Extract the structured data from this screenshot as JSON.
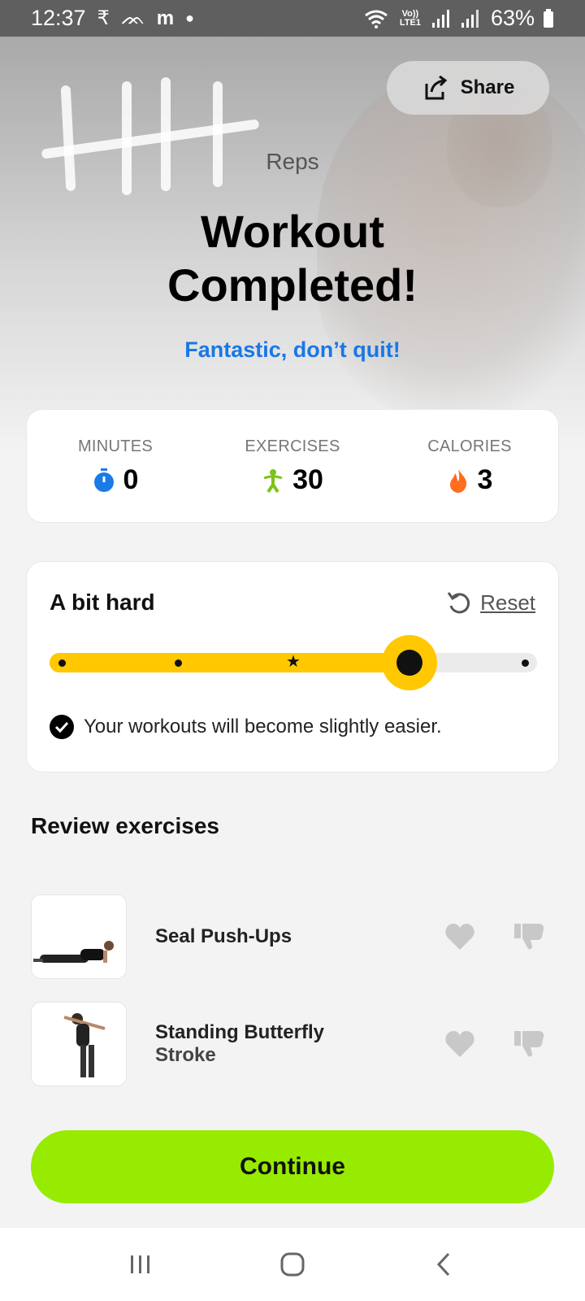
{
  "status_bar": {
    "time": "12:37",
    "notif_icons": [
      "rupee-icon",
      "sleep-icon",
      "m-app-icon",
      "dot-icon"
    ],
    "lte_label": "Vo)) LTE1",
    "battery": "63%"
  },
  "hero": {
    "share_label": "Share",
    "reps_label": "Reps",
    "title": "Workout Completed!",
    "subtitle": "Fantastic, don’t quit!"
  },
  "stats": {
    "minutes": {
      "label": "MINUTES",
      "value": "0",
      "icon": "stopwatch-icon",
      "color": "#1a7be6"
    },
    "exercises": {
      "label": "EXERCISES",
      "value": "30",
      "icon": "person-icon",
      "color": "#7cc41a"
    },
    "calories": {
      "label": "CALORIES",
      "value": "3",
      "icon": "flame-icon",
      "color": "#ff6d1f"
    }
  },
  "difficulty": {
    "title": "A bit hard",
    "reset_label": "Reset",
    "note": "Your workouts will become slightly easier.",
    "level": 4,
    "levels": 5,
    "star_level": 3,
    "accent": "#ffc800"
  },
  "review": {
    "title": "Review exercises",
    "exercises": [
      {
        "name_line1": "Seal Push-Ups",
        "name_line2": ""
      },
      {
        "name_line1": "Standing Butterfly",
        "name_line2": "Stroke"
      }
    ]
  },
  "continue_label": "Continue",
  "continue_color": "#96eb00"
}
